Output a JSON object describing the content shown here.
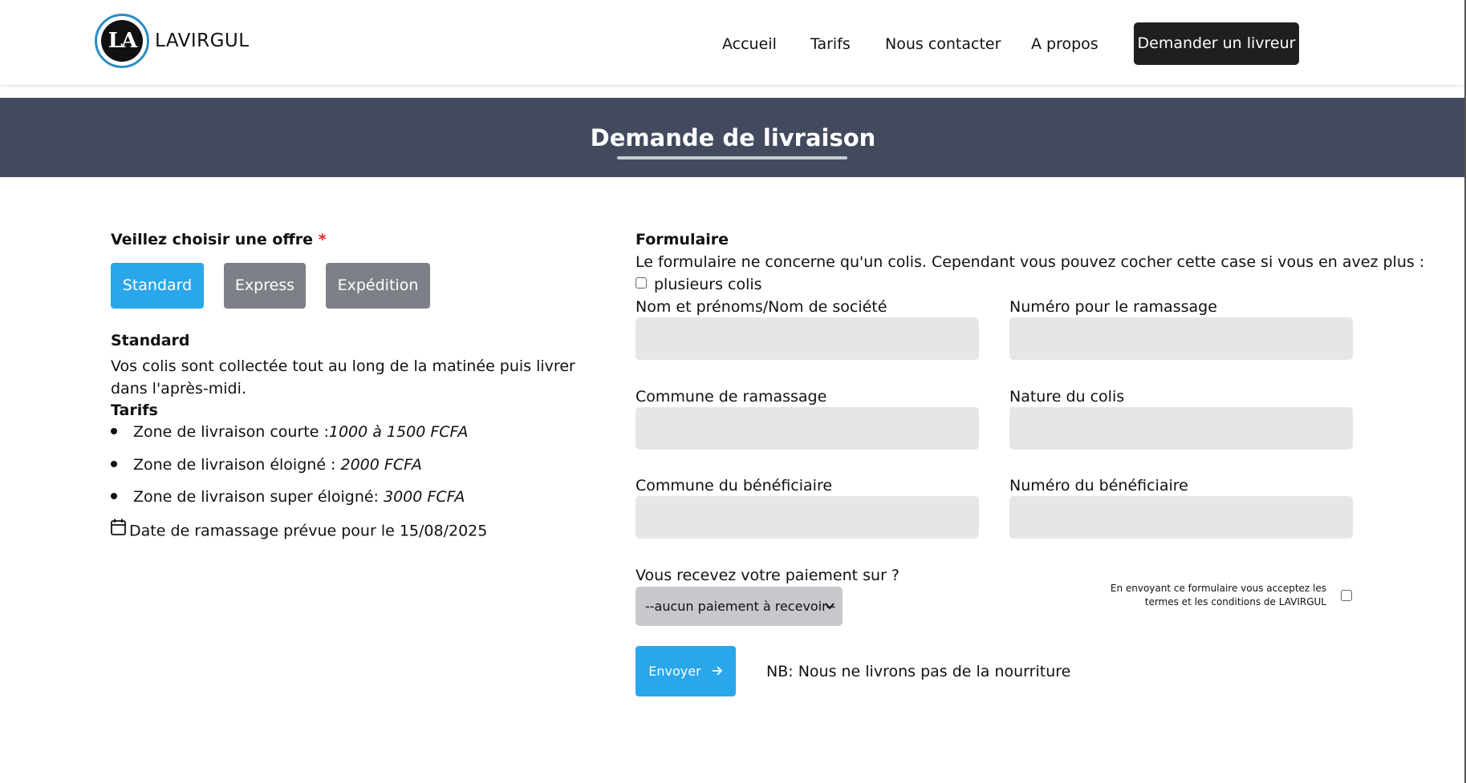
{
  "header": {
    "brand": "LAVIRGUL",
    "logo_text": "LA",
    "nav": [
      "Accueil",
      "Tarifs",
      "Nous contacter",
      "A propos"
    ],
    "cta": "Demander un livreur"
  },
  "banner": {
    "title": "Demande de livraison"
  },
  "offers": {
    "label": "Veillez choisir une offre",
    "required_mark": "*",
    "buttons": [
      "Standard",
      "Express",
      "Expédition"
    ],
    "selected": "Standard",
    "detail_title": "Standard",
    "description": "Vos colis sont collectée tout au long de la matinée puis livrer dans l'après-midi.",
    "tarifs_title": "Tarifs",
    "tarifs": [
      {
        "label": "Zone de livraison courte :",
        "price": "1000 à 1500 FCFA"
      },
      {
        "label": "Zone de livraison éloigné : ",
        "price": "2000 FCFA"
      },
      {
        "label": "Zone de livraison super éloigné: ",
        "price": "3000 FCFA"
      }
    ],
    "date_text": "Date de ramassage prévue pour le 15/08/2025"
  },
  "form": {
    "title": "Formulaire",
    "intro": "Le formulaire ne concerne qu'un colis. Cependant vous pouvez cocher cette case si vous en avez plus :",
    "multi_label": "plusieurs colis",
    "fields": {
      "name": "Nom et prénoms/Nom de société",
      "pickup_number": "Numéro pour le ramassage",
      "pickup_commune": "Commune de ramassage",
      "parcel_nature": "Nature du colis",
      "recipient_commune": "Commune du bénéficiaire",
      "recipient_number": "Numéro du bénéficiaire"
    },
    "payment_label": "Vous recevez votre paiement sur ?",
    "payment_selected": "--aucun paiement à recevoir--",
    "terms": "En envoyant ce formulaire vous acceptez les termes et les conditions de LAVIRGUL",
    "send": "Envoyer",
    "note": "NB: Nous ne livrons pas de la nourriture"
  },
  "colors": {
    "accent": "#2aa6ea",
    "banner": "#434a5e",
    "inactive": "#7d8086",
    "cta": "#1f1f1f",
    "required": "#e0202a"
  }
}
